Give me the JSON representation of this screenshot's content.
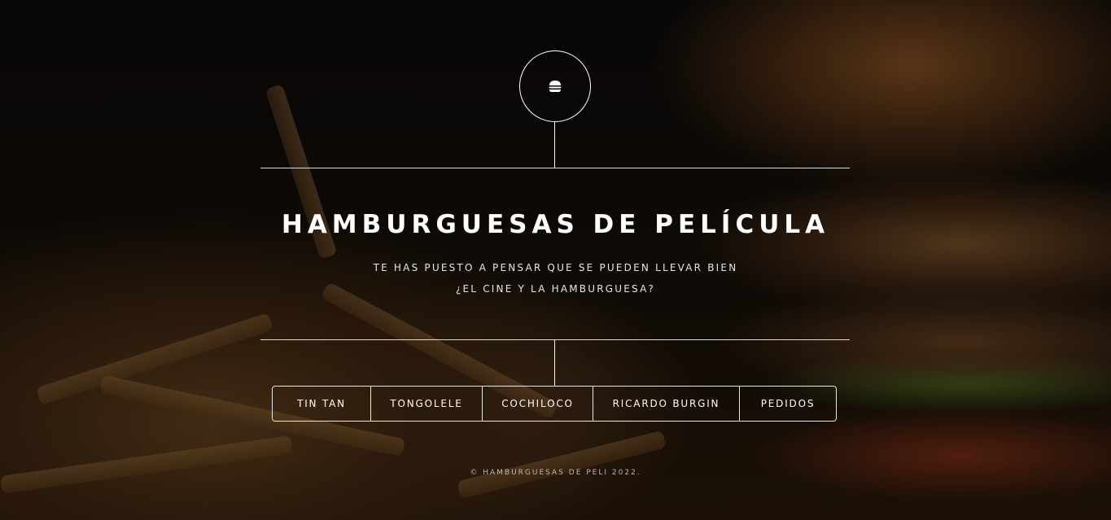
{
  "header": {
    "logo_icon": "burger-icon"
  },
  "hero": {
    "title": "HAMBURGUESAS DE PELÍCULA",
    "subtitle_line1": "TE HAS PUESTO A PENSAR QUE SE PUEDEN LLEVAR BIEN",
    "subtitle_line2": "¿EL CINE Y LA HAMBURGUESA?"
  },
  "nav": {
    "items": [
      {
        "label": "TIN TAN"
      },
      {
        "label": "TONGOLELE"
      },
      {
        "label": "COCHILOCO"
      },
      {
        "label": "RICARDO BURGIN"
      },
      {
        "label": "PEDIDOS"
      }
    ]
  },
  "footer": {
    "text": "© HAMBURGUESAS DE PELI 2022."
  },
  "colors": {
    "lines": "#ffffff",
    "text": "#ffffff"
  }
}
